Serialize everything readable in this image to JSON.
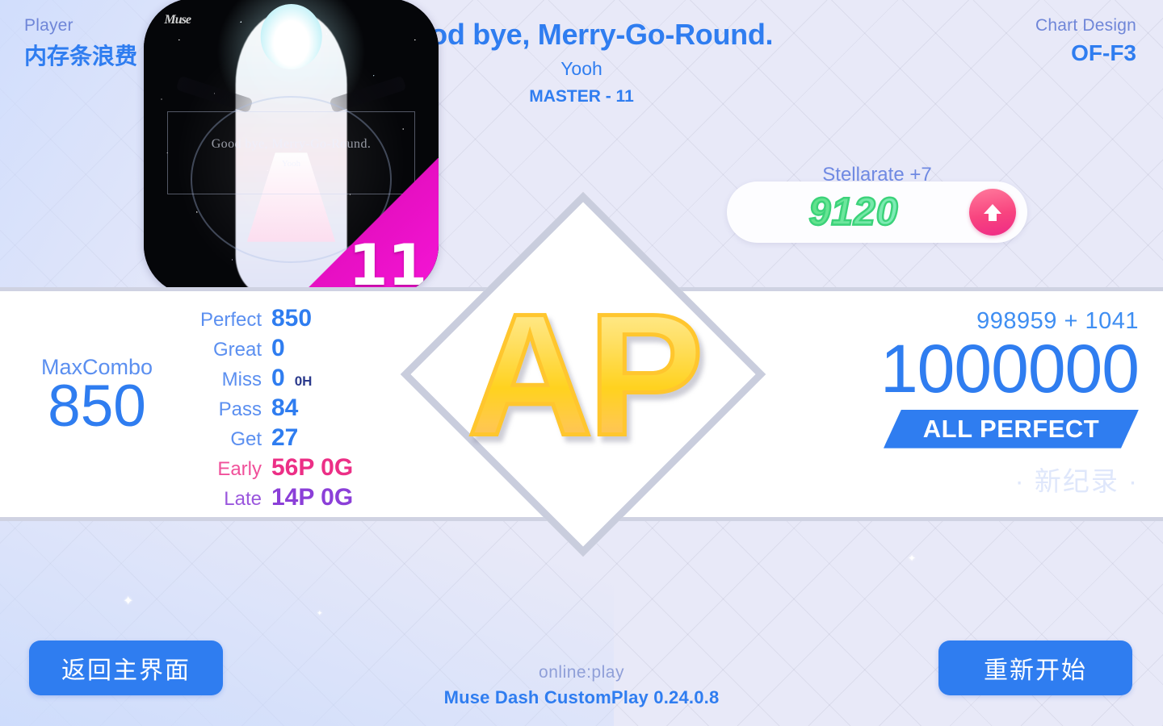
{
  "header": {
    "player_label": "Player",
    "player_name": "内存条浪费",
    "design_label": "Chart Design",
    "design_value": "OF-F3",
    "song_title": "Good bye, Merry-Go-Round.",
    "song_artist": "Yooh",
    "song_difficulty": "MASTER - 11"
  },
  "album": {
    "logo": "Muse",
    "overlay_title": "Good bye, Merry-Go-Round.",
    "overlay_artist": "Yooh",
    "difficulty_number": "11",
    "corner_color": "#ec12ce"
  },
  "stellarate": {
    "label": "Stellarate +7",
    "value": "9120",
    "arrow_icon": "arrow-up-icon",
    "value_color": "#3ed57b",
    "arrow_bg_color": "#f8447f"
  },
  "rank": {
    "badge_text": "AP",
    "badge_color": "#ffd21f"
  },
  "maxcombo": {
    "label": "MaxCombo",
    "value": "850"
  },
  "stats": [
    {
      "label": "Perfect",
      "value": "850",
      "sub": "",
      "tone": "blue"
    },
    {
      "label": "Great",
      "value": "0",
      "sub": "",
      "tone": "blue"
    },
    {
      "label": "Miss",
      "value": "0",
      "sub": "0H",
      "tone": "blue"
    },
    {
      "label": "Pass",
      "value": "84",
      "sub": "",
      "tone": "blue"
    },
    {
      "label": "Get",
      "value": "27",
      "sub": "",
      "tone": "blue"
    },
    {
      "label": "Early",
      "value": "56P 0G",
      "sub": "",
      "tone": "pink"
    },
    {
      "label": "Late",
      "value": "14P 0G",
      "sub": "",
      "tone": "purple"
    }
  ],
  "score": {
    "delta": "998959 + 1041",
    "total": "1000000",
    "rank_banner": "ALL PERFECT",
    "new_record": "· 新纪录 ·"
  },
  "bottom": {
    "back_label": "返回主界面",
    "restart_label": "重新开始",
    "mode": "online:play",
    "version": "Muse Dash CustomPlay 0.24.0.8"
  },
  "colors": {
    "accent_blue": "#2f7df0",
    "label_blue": "#5b8ff0",
    "early_pink": "#ec2f86",
    "late_purple": "#8b3fd8",
    "panel_white": "#ffffff",
    "panel_border": "#cfd2e2"
  }
}
